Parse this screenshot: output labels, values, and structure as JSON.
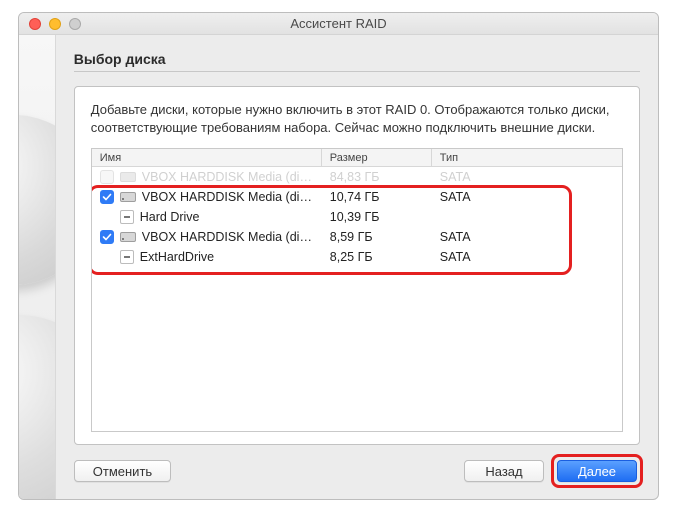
{
  "window": {
    "title": "Ассистент RAID"
  },
  "page": {
    "heading": "Выбор диска",
    "description": "Добавьте диски, которые нужно включить в этот RAID 0. Отображаются только диски, соответствующие требованиям набора. Сейчас можно подключить внешние диски."
  },
  "table": {
    "columns": {
      "name": "Имя",
      "size": "Размер",
      "type": "Тип"
    },
    "ghost_row": {
      "name": "VBOX HARDDISK Media (di…",
      "size": "84,83 ГБ",
      "type": "SATA"
    },
    "rows": [
      {
        "kind": "disk",
        "checked": true,
        "name": "VBOX HARDDISK Media (di…",
        "size": "10,74 ГБ",
        "type": "SATA"
      },
      {
        "kind": "volume",
        "name": "Hard Drive",
        "size": "10,39 ГБ",
        "type": ""
      },
      {
        "kind": "disk",
        "checked": true,
        "name": "VBOX HARDDISK Media (di…",
        "size": "8,59 ГБ",
        "type": "SATA"
      },
      {
        "kind": "volume",
        "name": "ExtHardDrive",
        "size": "8,25 ГБ",
        "type": "SATA"
      }
    ]
  },
  "buttons": {
    "cancel": "Отменить",
    "back": "Назад",
    "next": "Далее"
  },
  "annotations": {
    "highlight_rows": true,
    "highlight_next": true
  },
  "colors": {
    "accent": "#1f6df2",
    "annotation": "#e42020"
  }
}
